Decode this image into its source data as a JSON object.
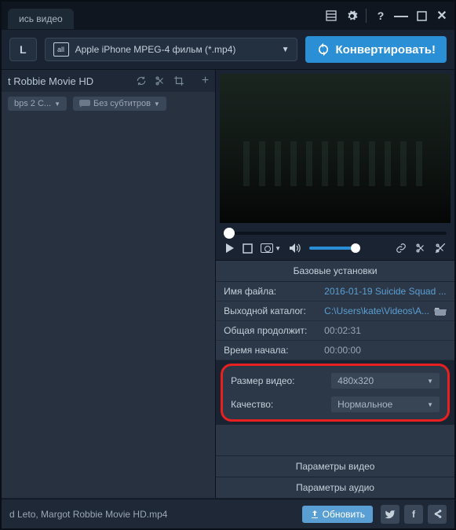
{
  "titlebar": {
    "tab_label": "ись видео"
  },
  "toolbar": {
    "L_label": "L",
    "profile_icon": "all",
    "profile_text": "Apple iPhone MPEG-4 фильм (*.mp4)",
    "convert_label": "Конвертировать!"
  },
  "file": {
    "title": "t Robbie Movie HD",
    "bitrate": "bps 2 C...",
    "subtitles": "Без субтитров"
  },
  "settings": {
    "title": "Базовые установки",
    "rows": {
      "filename": {
        "label": "Имя файла:",
        "value": "2016-01-19 Suicide Squad ..."
      },
      "outdir": {
        "label": "Выходной каталог:",
        "value": "C:\\Users\\kate\\Videos\\A..."
      },
      "duration": {
        "label": "Общая продолжит:",
        "value": "00:02:31"
      },
      "starttime": {
        "label": "Время начала:",
        "value": "00:00:00"
      },
      "size": {
        "label": "Размер видео:",
        "value": "480x320"
      },
      "quality": {
        "label": "Качество:",
        "value": "Нормальное"
      }
    },
    "video_params": "Параметры видео",
    "audio_params": "Параметры аудио"
  },
  "footer": {
    "filename": "d Leto, Margot Robbie Movie HD.mp4",
    "update": "Обновить"
  }
}
